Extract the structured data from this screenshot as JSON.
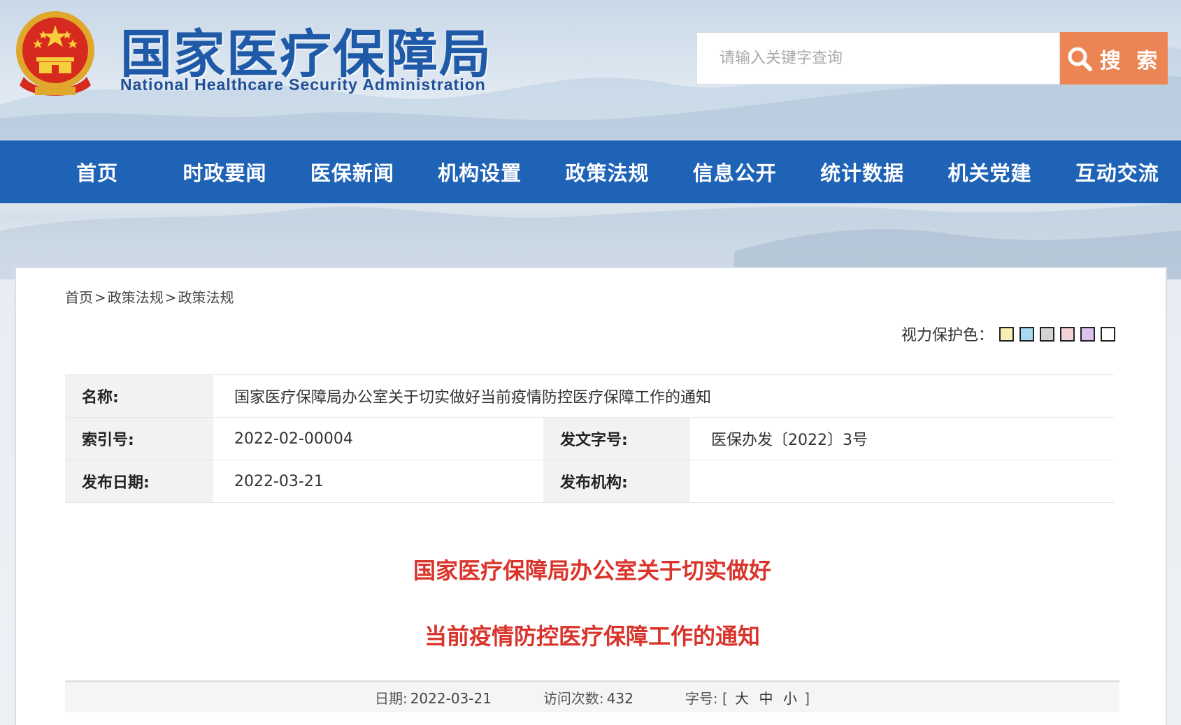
{
  "header": {
    "title": "国家医疗保障局",
    "subtitle": "National Healthcare Security Administration",
    "search_placeholder": "请输入关键字查询",
    "search_button": "搜 索"
  },
  "nav": {
    "items": [
      "首页",
      "时政要闻",
      "医保新闻",
      "机构设置",
      "政策法规",
      "信息公开",
      "统计数据",
      "机关党建",
      "互动交流"
    ]
  },
  "breadcrumb": {
    "home": "首页",
    "level1": "政策法规",
    "level2": "政策法规",
    "separator": ">"
  },
  "eye_protect": {
    "label": "视力保护色：",
    "colors": [
      "#f6f0b4",
      "#a9d8f1",
      "#d3d3d3",
      "#f3d3d8",
      "#dcc3ee",
      "#ffffff"
    ]
  },
  "meta": {
    "name_label": "名称:",
    "name_value": "国家医疗保障局办公室关于切实做好当前疫情防控医疗保障工作的通知",
    "index_label": "索引号:",
    "index_value": "2022-02-00004",
    "doc_no_label": "发文字号:",
    "doc_no_value": "医保办发〔2022〕3号",
    "date_label": "发布日期:",
    "date_value": "2022-03-21",
    "org_label": "发布机构:",
    "org_value": ""
  },
  "article": {
    "title_line1": "国家医疗保障局办公室关于切实做好",
    "title_line2": "当前疫情防控医疗保障工作的通知"
  },
  "info_bar": {
    "date_label": "日期:",
    "date_value": "2022-03-21",
    "visits_label": "访问次数:",
    "visits_value": "432",
    "font_label": "字号:",
    "bracket_open": "[",
    "large": "大",
    "medium": "中",
    "small": "小",
    "bracket_close": "]"
  },
  "colors": {
    "nav_bg": "#1f63b7",
    "title_blue": "#1f5aa8",
    "search_orange": "#ec8553",
    "article_title_red": "#d9342b"
  }
}
